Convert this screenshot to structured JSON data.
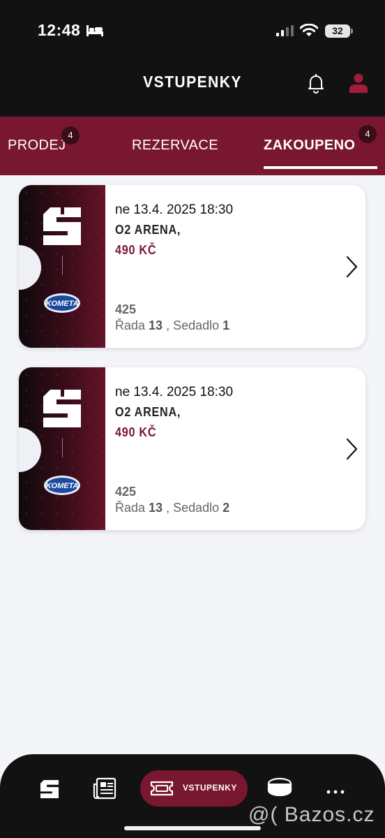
{
  "status_bar": {
    "time": "12:48",
    "battery": "32"
  },
  "header": {
    "title": "VSTUPENKY"
  },
  "tabs": [
    {
      "label": "PRODEJ",
      "badge": "4"
    },
    {
      "label": "REZERVACE",
      "badge": ""
    },
    {
      "label": "ZAKOUPENO",
      "badge": "4"
    }
  ],
  "tickets": [
    {
      "datetime": "ne 13.4. 2025 18:30",
      "venue": "O2 ARENA,",
      "price": "490 KČ",
      "section": "425",
      "row_label": "Řada",
      "row": "13",
      "seat_label": "Sedadlo",
      "seat": "1",
      "logo_text": "KOMETA"
    },
    {
      "datetime": "ne 13.4. 2025 18:30",
      "venue": "O2 ARENA,",
      "price": "490 KČ",
      "section": "425",
      "row_label": "Řada",
      "row": "13",
      "seat_label": "Sedadlo",
      "seat": "2",
      "logo_text": "KOMETA"
    }
  ],
  "bottom_nav": {
    "items": [
      {
        "icon": "club-logo-icon"
      },
      {
        "icon": "news-icon"
      },
      {
        "icon": "ticket-icon",
        "label": "VSTUPENKY"
      },
      {
        "icon": "puck-icon"
      },
      {
        "icon": "more-icon"
      }
    ]
  },
  "watermark": "@( Bazos.cz",
  "colors": {
    "accent": "#7a1730",
    "background": "#f4f5f9",
    "bar": "#121212"
  }
}
